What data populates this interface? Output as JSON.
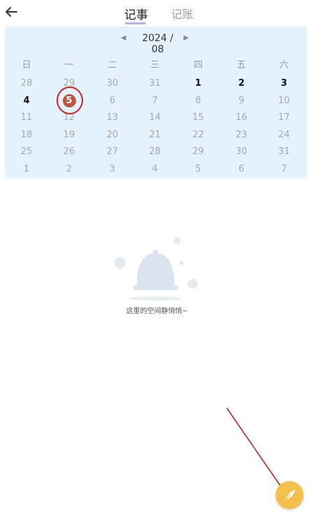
{
  "header": {
    "tabs": [
      {
        "label": "记事",
        "active": true
      },
      {
        "label": "记账",
        "active": false
      }
    ]
  },
  "calendar": {
    "month_label": "2024 / 08",
    "weekdays": [
      "日",
      "一",
      "二",
      "三",
      "四",
      "五",
      "六"
    ],
    "weeks": [
      [
        {
          "d": "28",
          "s": "muted"
        },
        {
          "d": "29",
          "s": "muted"
        },
        {
          "d": "30",
          "s": "muted"
        },
        {
          "d": "31",
          "s": "muted"
        },
        {
          "d": "1",
          "s": "strong"
        },
        {
          "d": "2",
          "s": "strong"
        },
        {
          "d": "3",
          "s": "strong"
        }
      ],
      [
        {
          "d": "4",
          "s": "strong"
        },
        {
          "d": "5",
          "s": "today"
        },
        {
          "d": "6",
          "s": "muted"
        },
        {
          "d": "7",
          "s": "muted"
        },
        {
          "d": "8",
          "s": "muted"
        },
        {
          "d": "9",
          "s": "muted"
        },
        {
          "d": "10",
          "s": "muted"
        }
      ],
      [
        {
          "d": "11",
          "s": "muted"
        },
        {
          "d": "12",
          "s": "muted"
        },
        {
          "d": "13",
          "s": "muted"
        },
        {
          "d": "14",
          "s": "muted"
        },
        {
          "d": "15",
          "s": "muted"
        },
        {
          "d": "16",
          "s": "muted"
        },
        {
          "d": "17",
          "s": "muted"
        }
      ],
      [
        {
          "d": "18",
          "s": "muted"
        },
        {
          "d": "19",
          "s": "muted"
        },
        {
          "d": "20",
          "s": "muted"
        },
        {
          "d": "21",
          "s": "muted"
        },
        {
          "d": "22",
          "s": "muted"
        },
        {
          "d": "23",
          "s": "muted"
        },
        {
          "d": "24",
          "s": "muted"
        }
      ],
      [
        {
          "d": "25",
          "s": "muted"
        },
        {
          "d": "26",
          "s": "muted"
        },
        {
          "d": "27",
          "s": "muted"
        },
        {
          "d": "28",
          "s": "muted"
        },
        {
          "d": "29",
          "s": "muted"
        },
        {
          "d": "30",
          "s": "muted"
        },
        {
          "d": "31",
          "s": "muted"
        }
      ],
      [
        {
          "d": "1",
          "s": "muted"
        },
        {
          "d": "2",
          "s": "muted"
        },
        {
          "d": "3",
          "s": "muted"
        },
        {
          "d": "4",
          "s": "muted"
        },
        {
          "d": "5",
          "s": "muted"
        },
        {
          "d": "6",
          "s": "muted"
        },
        {
          "d": "7",
          "s": "muted"
        }
      ]
    ]
  },
  "empty_state": {
    "text": "这里的空间静悄悄~",
    "icon": "bell-icon"
  },
  "fab": {
    "icon": "feather-pen-icon"
  },
  "colors": {
    "calendar_bg": "#e3f2fd",
    "today": "#c0533d",
    "annotation": "#d21f1f",
    "fab": "#f5c04a",
    "tab_underline": "#b7b2f0"
  }
}
